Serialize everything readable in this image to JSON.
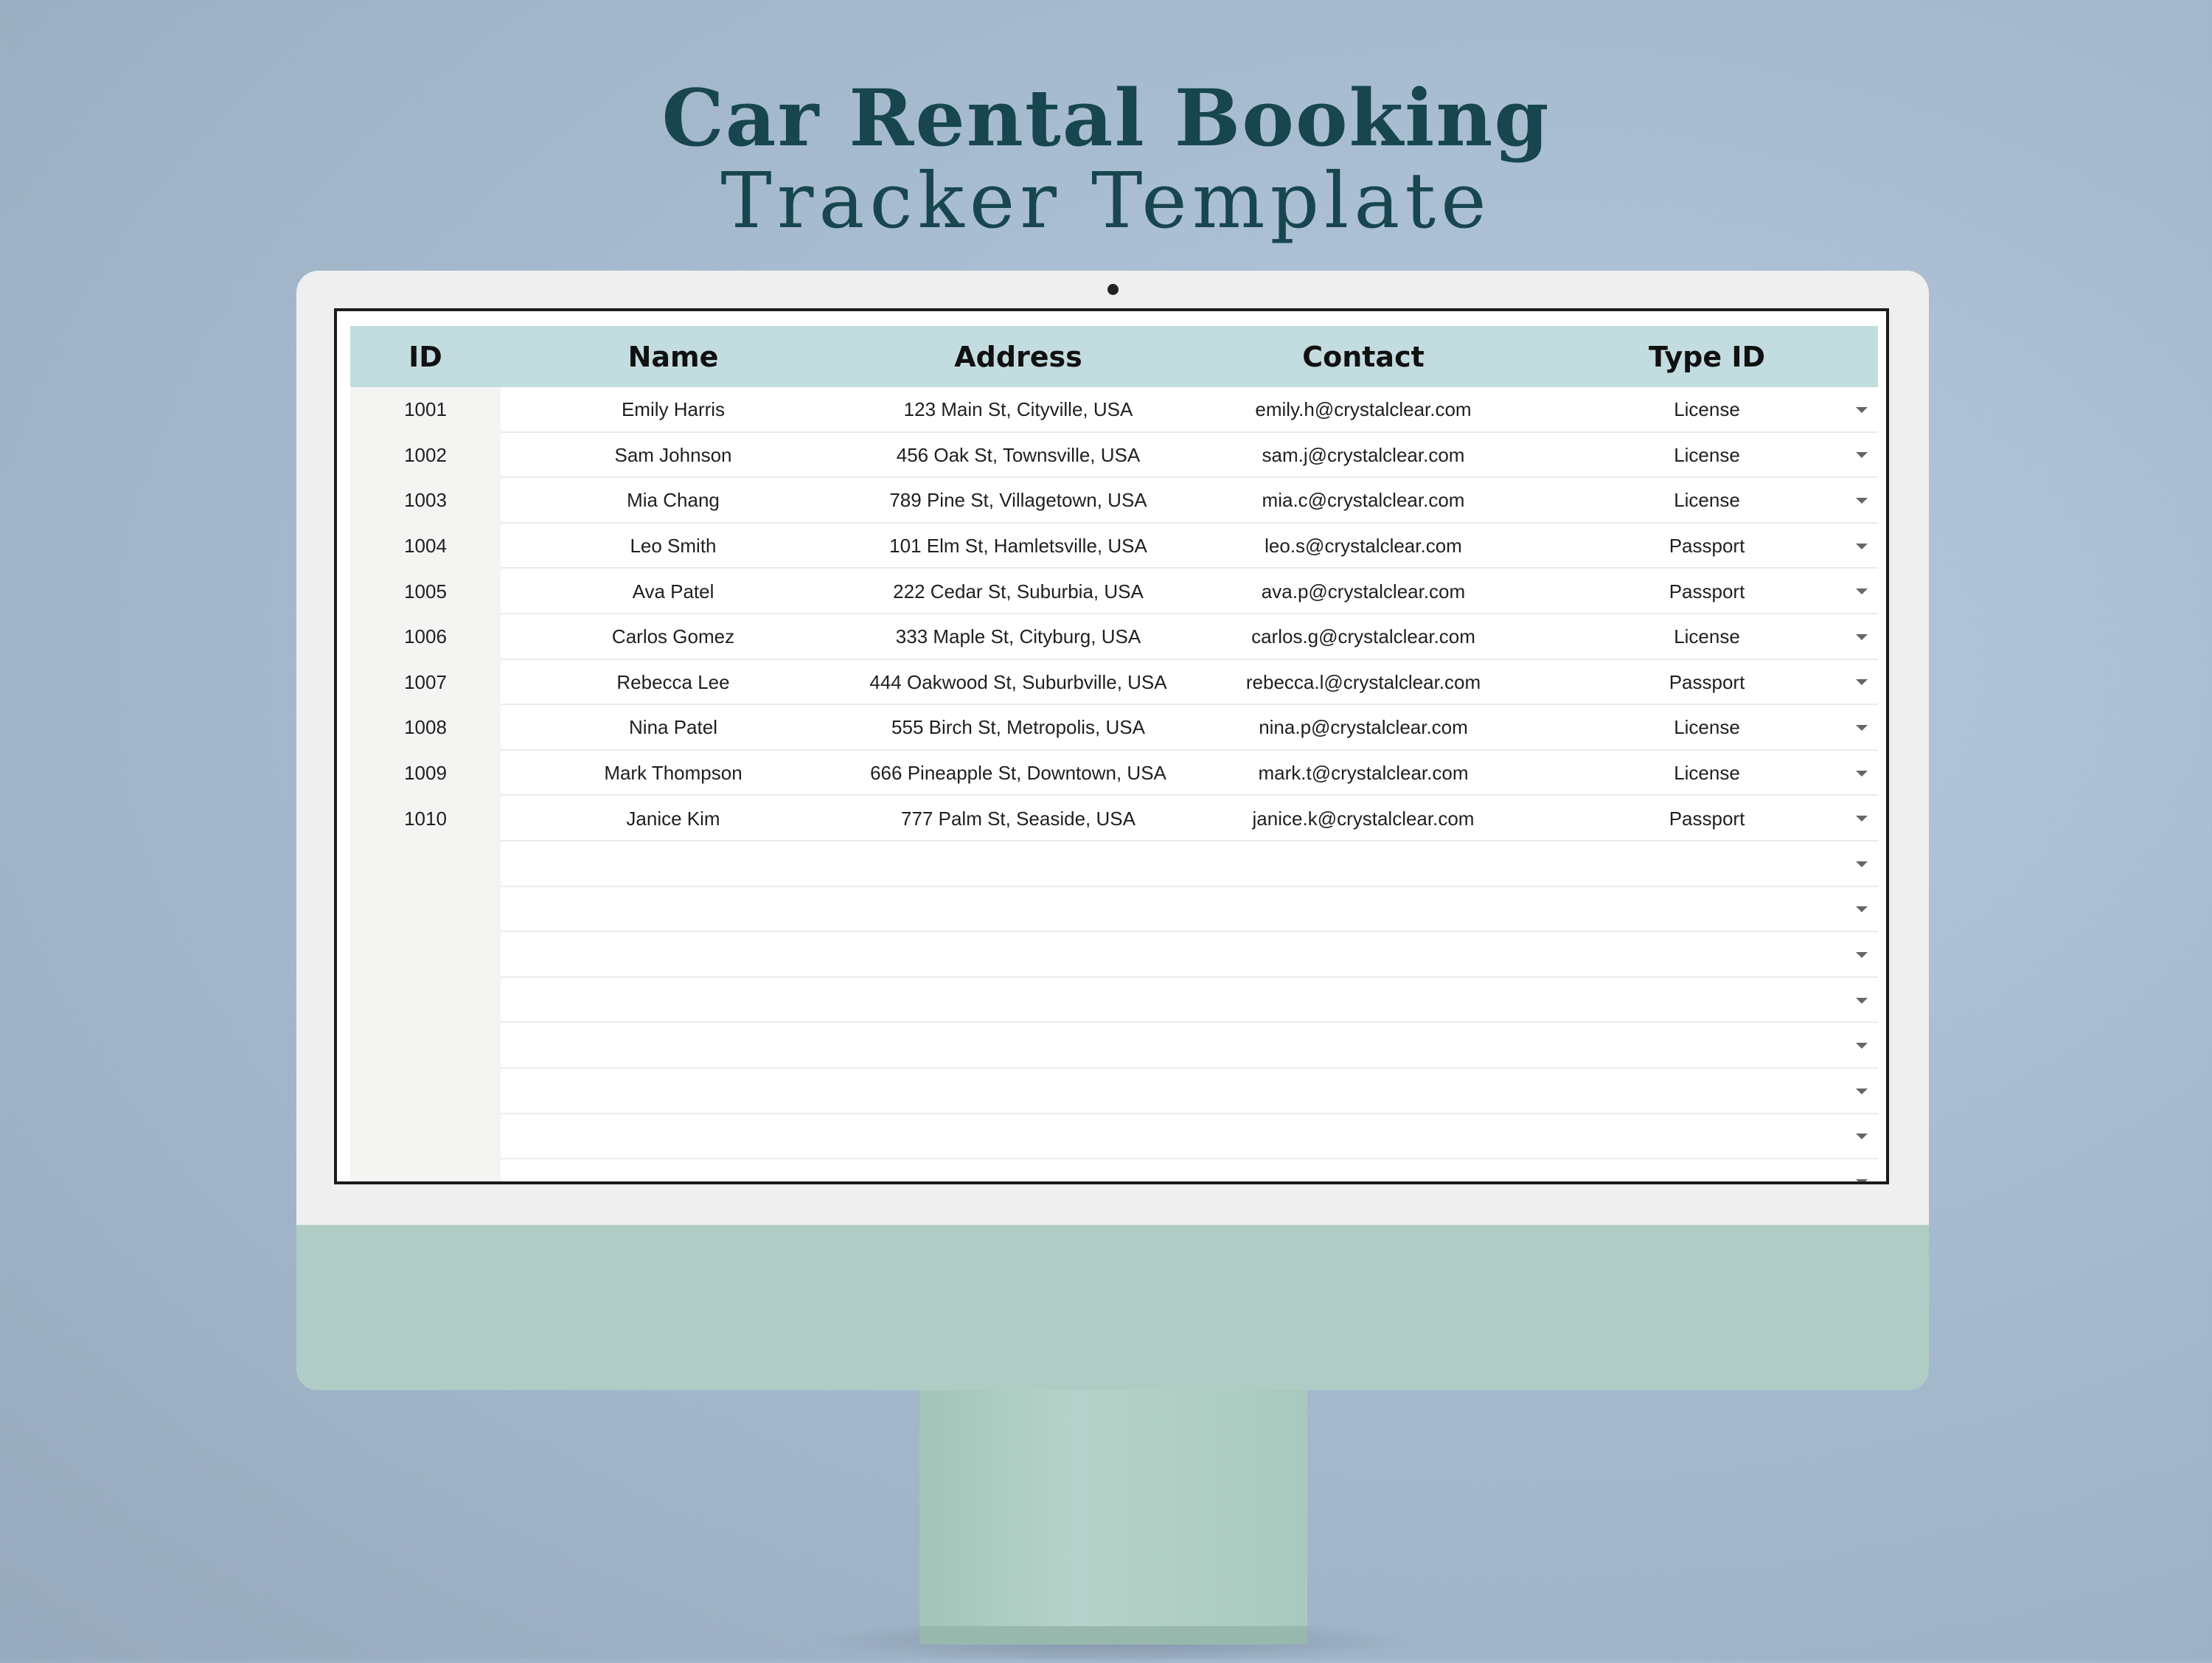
{
  "title": {
    "line1": "Car Rental Booking",
    "line2": "Tracker Template"
  },
  "table": {
    "headers": {
      "id": "ID",
      "name": "Name",
      "address": "Address",
      "contact": "Contact",
      "type": "Type ID"
    },
    "rows": [
      {
        "id": "1001",
        "name": "Emily Harris",
        "address": "123 Main St, Cityville, USA",
        "contact": "emily.h@crystalclear.com",
        "type": "License"
      },
      {
        "id": "1002",
        "name": "Sam Johnson",
        "address": "456 Oak St, Townsville, USA",
        "contact": "sam.j@crystalclear.com",
        "type": "License"
      },
      {
        "id": "1003",
        "name": "Mia Chang",
        "address": "789 Pine St, Villagetown, USA",
        "contact": "mia.c@crystalclear.com",
        "type": "License"
      },
      {
        "id": "1004",
        "name": "Leo Smith",
        "address": "101 Elm St, Hamletsville, USA",
        "contact": "leo.s@crystalclear.com",
        "type": "Passport"
      },
      {
        "id": "1005",
        "name": "Ava Patel",
        "address": "222 Cedar St, Suburbia, USA",
        "contact": "ava.p@crystalclear.com",
        "type": "Passport"
      },
      {
        "id": "1006",
        "name": "Carlos Gomez",
        "address": "333 Maple St, Cityburg, USA",
        "contact": "carlos.g@crystalclear.com",
        "type": "License"
      },
      {
        "id": "1007",
        "name": "Rebecca Lee",
        "address": "444 Oakwood St, Suburbville, USA",
        "contact": "rebecca.l@crystalclear.com",
        "type": "Passport"
      },
      {
        "id": "1008",
        "name": "Nina Patel",
        "address": "555 Birch St, Metropolis, USA",
        "contact": "nina.p@crystalclear.com",
        "type": "License"
      },
      {
        "id": "1009",
        "name": "Mark Thompson",
        "address": "666 Pineapple St, Downtown, USA",
        "contact": "mark.t@crystalclear.com",
        "type": "License"
      },
      {
        "id": "1010",
        "name": "Janice Kim",
        "address": "777 Palm St, Seaside, USA",
        "contact": "janice.k@crystalclear.com",
        "type": "Passport"
      },
      {
        "id": "",
        "name": "",
        "address": "",
        "contact": "",
        "type": ""
      },
      {
        "id": "",
        "name": "",
        "address": "",
        "contact": "",
        "type": ""
      },
      {
        "id": "",
        "name": "",
        "address": "",
        "contact": "",
        "type": ""
      },
      {
        "id": "",
        "name": "",
        "address": "",
        "contact": "",
        "type": ""
      },
      {
        "id": "",
        "name": "",
        "address": "",
        "contact": "",
        "type": ""
      },
      {
        "id": "",
        "name": "",
        "address": "",
        "contact": "",
        "type": ""
      },
      {
        "id": "",
        "name": "",
        "address": "",
        "contact": "",
        "type": ""
      },
      {
        "id": "",
        "name": "",
        "address": "",
        "contact": "",
        "type": ""
      }
    ],
    "dropdown_icon": "caret-down-icon"
  },
  "colors": {
    "title": "#17464e",
    "header_bg": "#c3dcdf",
    "monitor_chin": "#afcdc4",
    "monitor_bezel": "#efefef"
  }
}
